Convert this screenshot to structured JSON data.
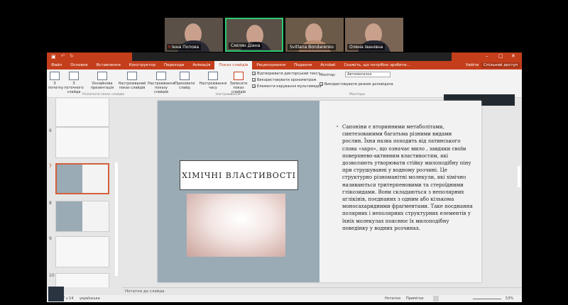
{
  "participants": [
    {
      "name": "Інна Попова",
      "muted": true
    },
    {
      "name": "Смілян Діана",
      "active": true
    },
    {
      "name": "Svitlana Bondarenko"
    },
    {
      "name": "Олена Іванівна"
    }
  ],
  "tabs": [
    "Файл",
    "Основне",
    "Вставлення",
    "Конструктор",
    "Переходи",
    "Анімація",
    "Показ слайдів",
    "Рецензування",
    "Подання",
    "Acrobat"
  ],
  "active_tab": "Показ слайдів",
  "tell_me": "Скажіть, що потрібно зробити...",
  "signin": "Увійти",
  "share": "Спільний доступ",
  "ribbon": {
    "buttons": [
      "З початку",
      "З поточного слайда",
      "Онлайнова презентація",
      "Настроюваний показ слайдів",
      "Настроювання показу слайдів",
      "Приховати слайд",
      "Настроювання часу",
      "Записати показ слайдів"
    ],
    "groups": [
      "Розпочати показ слайдів",
      "Настроювання",
      "Монітори"
    ],
    "checks": [
      "Відтворювати дикторський текст",
      "Використовувати хронометраж",
      "Елементи керування мультимедіа"
    ],
    "monitor_label": "Монітор:",
    "monitor_value": "Автоматично",
    "presenter_check": "Використовувати режим доповідача"
  },
  "thumbs": [
    "6",
    "7",
    "8",
    "9",
    "10"
  ],
  "slide": {
    "title": "ХІМІЧНІ ВЛАСТИВОСТІ",
    "body": "Сапоніни є вторинними метаболітами, синтезованими багатьма різними видами рослин. Їхня назва походить від латинського слова «sapo», що означає мило , завдяки своїм поверхнево-активним властивостям, які дозволяють утворювати стійку милоподібну піну при струшуванні у водному розчині. Це структурно різноманітні молекули, які хімічно називаються тритерпеновими та стероїдними глікозидами. Вони складаються з неполярних аглікінів, поєднаних з одним або кількома моносахаридними фрагментами. Таке поєднання полярних і неполярних структурних елементів у їхніх молекулах пояснює їх милоподібну поведінку у водних розчинах."
  },
  "notes_placeholder": "Нотатки до слайда",
  "status": {
    "slide": "Слайд 7 з 14",
    "lang": "українська",
    "notes": "Нотатки",
    "comments": "Примітки",
    "zoom": "53%"
  },
  "colors": {
    "accent": "#c43e1c",
    "slide_left": "#9aabb5"
  }
}
